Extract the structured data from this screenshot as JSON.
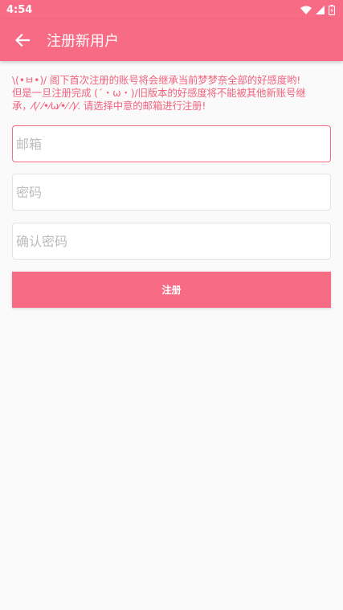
{
  "status_bar": {
    "time": "4:54"
  },
  "app_bar": {
    "title": "注册新用户"
  },
  "notice": {
    "line1": "\\(•ㅂ•)/ 阁下首次注册的账号将会继承当前梦梦奈全部的好感度哟!",
    "line2": "但是一旦注册完成 (´・ω・)/旧版本的好感度将不能被其他新账号继",
    "line3": "承，⁄(⁄ ⁄•⁄ω⁄•⁄ ⁄)⁄. 请选择中意的邮箱进行注册!"
  },
  "form": {
    "email_placeholder": "邮箱",
    "password_placeholder": "密码",
    "confirm_placeholder": "确认密码",
    "submit_label": "注册"
  },
  "colors": {
    "primary": "#f86b84",
    "notice_text": "#f0647e",
    "background": "#fafafa"
  },
  "icons": {
    "back": "arrow-left-icon",
    "wifi": "wifi-icon",
    "signal": "signal-icon",
    "battery": "battery-icon"
  }
}
